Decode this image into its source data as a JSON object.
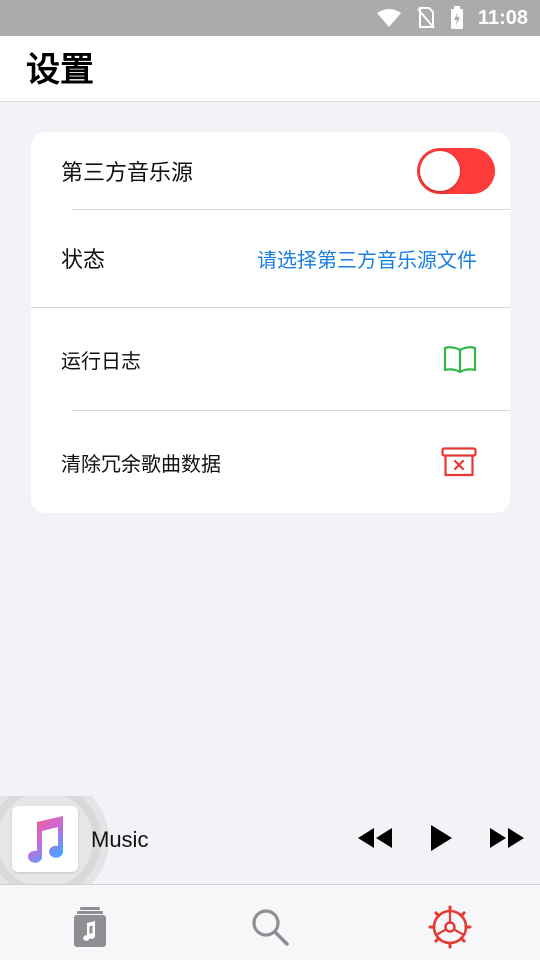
{
  "status_bar": {
    "time": "11:08",
    "icons": [
      "wifi-icon",
      "no-sim-icon",
      "battery-charging-icon"
    ]
  },
  "header": {
    "title": "设置"
  },
  "settings": {
    "third_party_source": {
      "label": "第三方音乐源",
      "enabled": false
    },
    "status": {
      "label": "状态",
      "value": "请选择第三方音乐源文件"
    },
    "run_log": {
      "label": "运行日志",
      "icon": "open-book-icon"
    },
    "clear_data": {
      "label": "清除冗余歌曲数据",
      "icon": "trash-bin-icon"
    }
  },
  "player": {
    "track": "Music",
    "art_icon": "music-note-icon",
    "controls": [
      "previous-icon",
      "play-icon",
      "next-icon"
    ]
  },
  "tabbar": {
    "tabs": [
      {
        "icon": "library-icon",
        "active": false
      },
      {
        "icon": "search-icon",
        "active": false
      },
      {
        "icon": "settings-gear-icon",
        "active": true
      }
    ]
  },
  "colors": {
    "accent": "#ff3b3b",
    "link": "#1a7fe0",
    "log_icon": "#2fb84a",
    "inactive_tab": "#8e8e93",
    "background": "#f2f2f7"
  }
}
